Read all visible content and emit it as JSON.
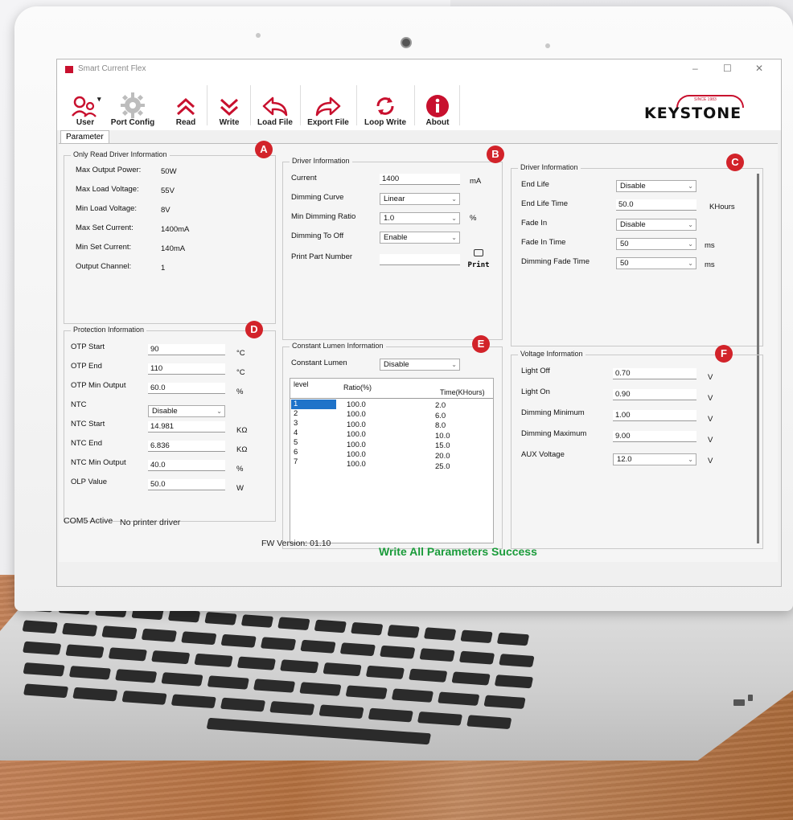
{
  "window": {
    "title": "Smart Current Flex",
    "controls": [
      "–",
      "☐",
      "✕"
    ]
  },
  "toolbar": {
    "buttons": [
      {
        "label": "User",
        "icon": "user-icon"
      },
      {
        "label": "Port Config",
        "icon": "gear-icon"
      },
      {
        "label": "Read",
        "icon": "double-chevron-up-icon"
      },
      {
        "label": "Write",
        "icon": "double-chevron-down-icon"
      },
      {
        "label": "Load File",
        "icon": "arrow-left-icon"
      },
      {
        "label": "Export File",
        "icon": "arrow-right-icon"
      },
      {
        "label": "Loop Write",
        "icon": "refresh-icon"
      },
      {
        "label": "About",
        "icon": "info-icon"
      }
    ],
    "user_caret": "▾"
  },
  "brand": {
    "name": "KEYSTONE",
    "since": "SINCE 1983"
  },
  "tab": {
    "label": "Parameter"
  },
  "badges": [
    "A",
    "B",
    "C",
    "D",
    "E",
    "F"
  ],
  "only_read": {
    "title": "Only Read Driver Information",
    "rows": [
      {
        "label": "Max Output Power:",
        "value": "50W"
      },
      {
        "label": "Max Load Voltage:",
        "value": "55V"
      },
      {
        "label": "Min Load Voltage:",
        "value": "8V"
      },
      {
        "label": "Max Set Current:",
        "value": "1400mA"
      },
      {
        "label": "Min Set Current:",
        "value": "140mA"
      },
      {
        "label": "Output Channel:",
        "value": "1"
      }
    ]
  },
  "driver_b": {
    "title": "Driver Information",
    "current_label": "Current",
    "current_value": "1400",
    "current_unit": "mA",
    "curve_label": "Dimming Curve",
    "curve_value": "Linear",
    "ratio_label": "Min Dimming Ratio",
    "ratio_value": "1.0",
    "ratio_unit": "%",
    "off_label": "Dimming To Off",
    "off_value": "Enable",
    "print_label": "Print Part Number",
    "print_button": "Print"
  },
  "driver_c": {
    "title": "Driver Information",
    "end_life_label": "End Life",
    "end_life_value": "Disable",
    "end_life_time_label": "End Life Time",
    "end_life_time_value": "50.0",
    "end_life_time_unit": "KHours",
    "fade_in_label": "Fade In",
    "fade_in_value": "Disable",
    "fade_in_time_label": "Fade In Time",
    "fade_in_time_value": "50",
    "fade_in_time_unit": "ms",
    "dim_fade_label": "Dimming Fade Time",
    "dim_fade_value": "50",
    "dim_fade_unit": "ms"
  },
  "protection": {
    "title": "Protection Information",
    "rows": [
      {
        "label": "OTP Start",
        "value": "90",
        "unit": "°C",
        "type": "input"
      },
      {
        "label": "OTP End",
        "value": "110",
        "unit": "°C",
        "type": "input"
      },
      {
        "label": "OTP Min Output",
        "value": "60.0",
        "unit": "%",
        "type": "input"
      },
      {
        "label": "NTC",
        "value": "Disable",
        "unit": "",
        "type": "select"
      },
      {
        "label": "NTC Start",
        "value": "14.981",
        "unit": "KΩ",
        "type": "input"
      },
      {
        "label": "NTC End",
        "value": "6.836",
        "unit": "KΩ",
        "type": "input"
      },
      {
        "label": "NTC Min Output",
        "value": "40.0",
        "unit": "%",
        "type": "input"
      },
      {
        "label": "OLP Value",
        "value": "50.0",
        "unit": "W",
        "type": "input"
      }
    ]
  },
  "constant_lumen": {
    "title": "Constant Lumen Information",
    "label": "Constant Lumen",
    "value": "Disable",
    "headers": [
      "level",
      "Ratio(%)",
      "Time(KHours)"
    ],
    "rows": [
      [
        "1",
        "100.0",
        "2.0"
      ],
      [
        "2",
        "100.0",
        "6.0"
      ],
      [
        "3",
        "100.0",
        "8.0"
      ],
      [
        "4",
        "100.0",
        "10.0"
      ],
      [
        "5",
        "100.0",
        "15.0"
      ],
      [
        "6",
        "100.0",
        "20.0"
      ],
      [
        "7",
        "100.0",
        "25.0"
      ]
    ]
  },
  "voltage": {
    "title": "Voltage Information",
    "rows": [
      {
        "label": "Light Off",
        "value": "0.70",
        "unit": "V",
        "type": "input"
      },
      {
        "label": "Light On",
        "value": "0.90",
        "unit": "V",
        "type": "input"
      },
      {
        "label": "Dimming Minimum",
        "value": "1.00",
        "unit": "V",
        "type": "input"
      },
      {
        "label": "Dimming Maximum",
        "value": "9.00",
        "unit": "V",
        "type": "input"
      },
      {
        "label": "AUX Voltage",
        "value": "12.0",
        "unit": "V",
        "type": "select"
      }
    ]
  },
  "status": {
    "port": "COM5 Active",
    "printer": "No printer driver",
    "fw": "FW Version: 01.10",
    "message": "Write All Parameters Success"
  },
  "colors": {
    "accent": "#c8102e",
    "success": "#1a9b3a",
    "badge": "#d2232a",
    "selected_row": "#1f73c9"
  }
}
